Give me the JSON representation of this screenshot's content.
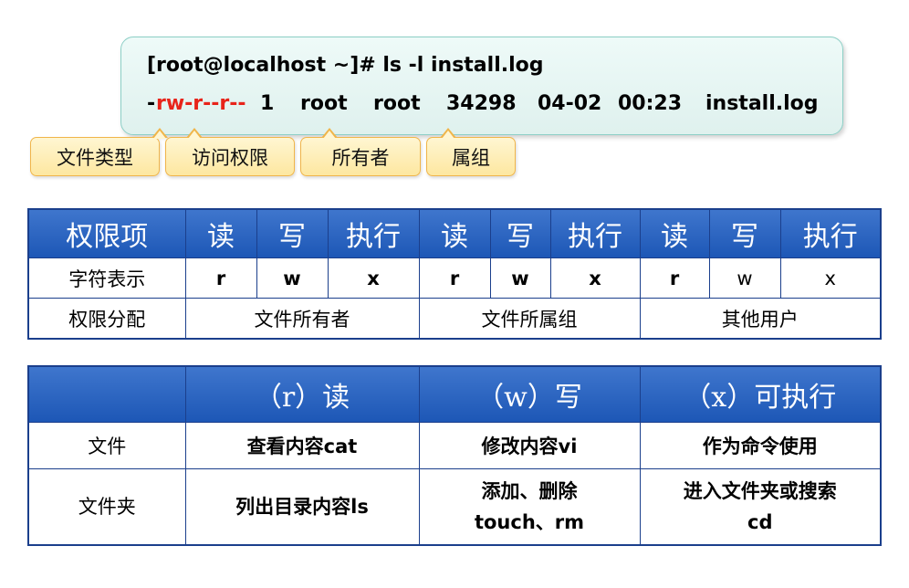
{
  "terminal": {
    "command": "[root@localhost ~]# ls -l install.log",
    "listing": {
      "type_char": "-",
      "permissions": "rw-r--r--",
      "links": "1",
      "owner": "root",
      "group": "root",
      "size": "34298",
      "date": "04-02",
      "time": "00:23",
      "filename": "install.log"
    }
  },
  "callouts": [
    "文件类型",
    "访问权限",
    "所有者",
    "属组"
  ],
  "permission_table": {
    "header_label": "权限项",
    "header_cells": [
      "读",
      "写",
      "执行",
      "读",
      "写",
      "执行",
      "读",
      "写",
      "执行"
    ],
    "symbol_row_label": "字符表示",
    "symbols": [
      "r",
      "w",
      "x",
      "r",
      "w",
      "x",
      "r",
      "w",
      "x"
    ],
    "assign_row_label": "权限分配",
    "assignments": [
      "文件所有者",
      "文件所属组",
      "其他用户"
    ]
  },
  "meaning_table": {
    "headers": [
      "",
      "（r）读",
      "（w）写",
      "（x）可执行"
    ],
    "rows": [
      {
        "label": "文件",
        "read": "查看内容cat",
        "write": "修改内容vi",
        "exec": "作为命令使用"
      },
      {
        "label": "文件夹",
        "read": "列出目录内容ls",
        "write_line1": "添加、删除",
        "write_line2": "touch、rm",
        "exec_line1": "进入文件夹或搜索",
        "exec_line2": "cd"
      }
    ]
  },
  "colors": {
    "header_blue": "#1d57b6",
    "permission_red": "#e8241a",
    "callout_fill": "#fde7a0",
    "terminal_fill": "#dff1ee"
  }
}
